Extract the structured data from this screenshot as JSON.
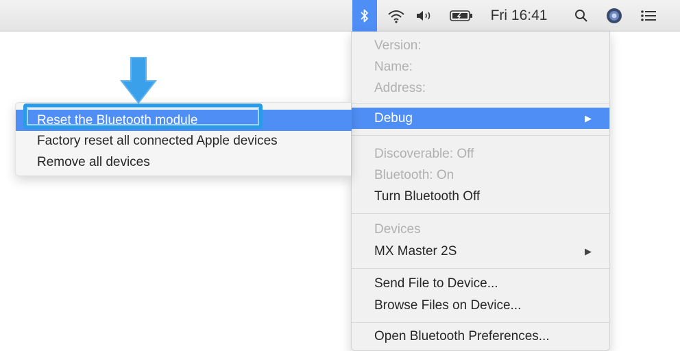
{
  "menubar": {
    "icons": [
      "bluetooth-icon",
      "wifi-icon",
      "volume-icon",
      "battery-icon",
      "search-icon",
      "avatar-icon",
      "list-icon"
    ],
    "clock": "Fri 16:41"
  },
  "bluetooth_menu": {
    "info": {
      "version": "Version:",
      "name": "Name:",
      "address": "Address:"
    },
    "debug": "Debug",
    "status": {
      "discoverable": "Discoverable: Off",
      "bluetooth": "Bluetooth: On",
      "turn_off": "Turn Bluetooth Off"
    },
    "devices": {
      "header": "Devices",
      "device": "MX Master 2S"
    },
    "files": {
      "send": "Send File to Device...",
      "browse": "Browse Files on Device..."
    },
    "preferences": "Open Bluetooth Preferences..."
  },
  "debug_submenu": {
    "items": [
      "Reset the Bluetooth module",
      "Factory reset all connected Apple devices",
      "Remove all devices"
    ]
  },
  "annotation": {
    "arrow_color": "#3aa0ea",
    "highlight_color": "#2b9be8"
  },
  "colors": {
    "selection": "#4f8ef5"
  }
}
